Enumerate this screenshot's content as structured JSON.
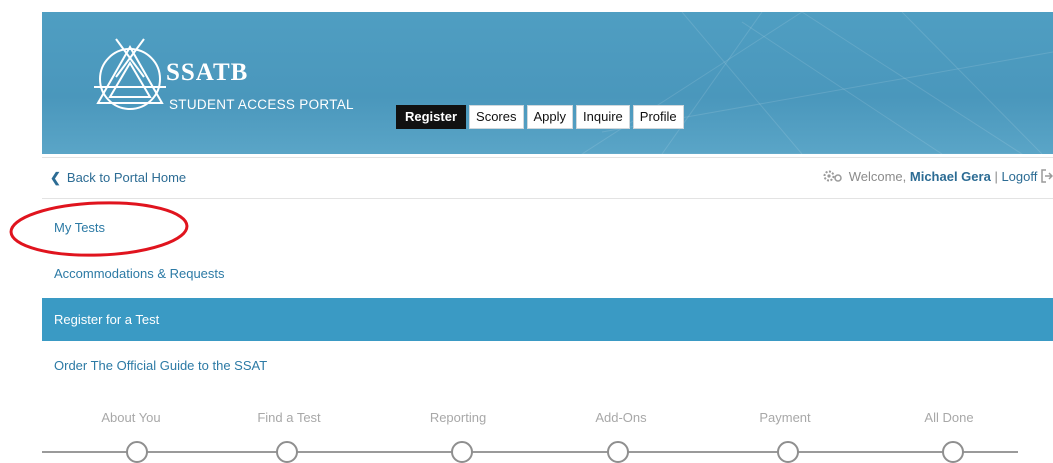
{
  "header": {
    "brand": "SSATB",
    "subtitle": "STUDENT ACCESS PORTAL",
    "tabs": [
      {
        "label": "Register",
        "active": true
      },
      {
        "label": "Scores",
        "active": false
      },
      {
        "label": "Apply",
        "active": false
      },
      {
        "label": "Inquire",
        "active": false
      },
      {
        "label": "Profile",
        "active": false
      }
    ],
    "color": "#4a97bc"
  },
  "subbar": {
    "back_label": "Back to Portal Home",
    "welcome_prefix": "Welcome,",
    "user_name": "Michael Gera",
    "separator": "|",
    "logoff_label": "Logoff",
    "gear_icon": "gear-icon",
    "logout_icon": "logout-icon"
  },
  "menu": {
    "items": [
      {
        "label": "My Tests"
      },
      {
        "label": "Accommodations & Requests"
      },
      {
        "label": "Register for a Test",
        "active": true
      },
      {
        "label": "Order The Official Guide to the SSAT"
      }
    ]
  },
  "steps": [
    {
      "label": "About You"
    },
    {
      "label": "Find a Test"
    },
    {
      "label": "Reporting"
    },
    {
      "label": "Add-Ons"
    },
    {
      "label": "Payment"
    },
    {
      "label": "All Done"
    }
  ],
  "colors": {
    "accent": "#3a9ac4",
    "link": "#2c7aa5",
    "highlight": "#e0141e"
  }
}
